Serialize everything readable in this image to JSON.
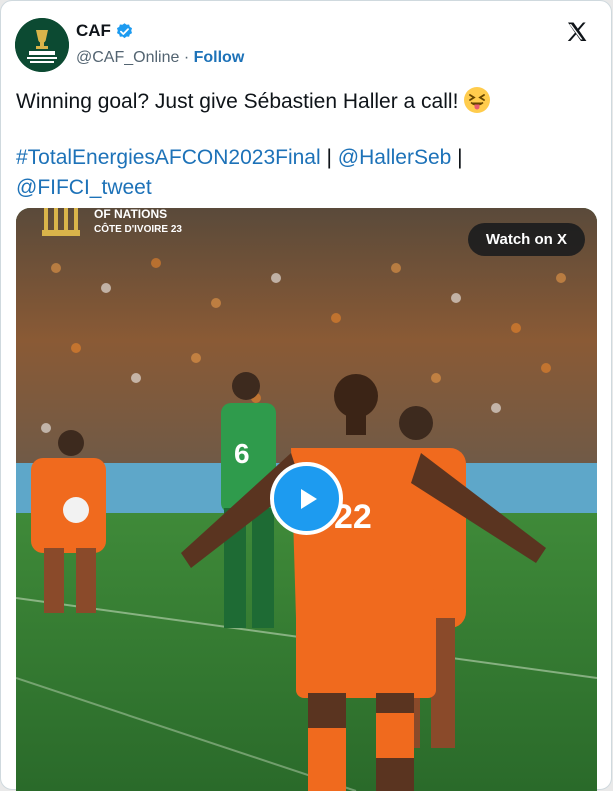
{
  "author": {
    "name": "CAF",
    "handle": "@CAF_Online",
    "separator": " · ",
    "follow_label": "Follow"
  },
  "tweet": {
    "line1": "Winning goal? Just give Sébastien Haller a call!",
    "emoji": "squinting-face-with-tongue",
    "hashtag": "#TotalEnergiesAFCON2023Final",
    "pipe": " | ",
    "mention1": "@HallerSeb",
    "mention2": "@FIFCI_tweet"
  },
  "media": {
    "watch_label": "Watch on X",
    "overlay_line1": "OF NATIONS",
    "overlay_line2": "CÔTE D'IVOIRE 23",
    "player_number": "22",
    "opponent_number": "6"
  },
  "colors": {
    "link": "#1d72b8",
    "verified": "#1d9bf0",
    "play": "#1d9bf0",
    "kit_orange": "#f06a1e",
    "kit_green": "#2f9b4c"
  },
  "icons": [
    "caf-logo-icon",
    "verified-badge-icon",
    "x-logo-icon",
    "play-icon"
  ]
}
